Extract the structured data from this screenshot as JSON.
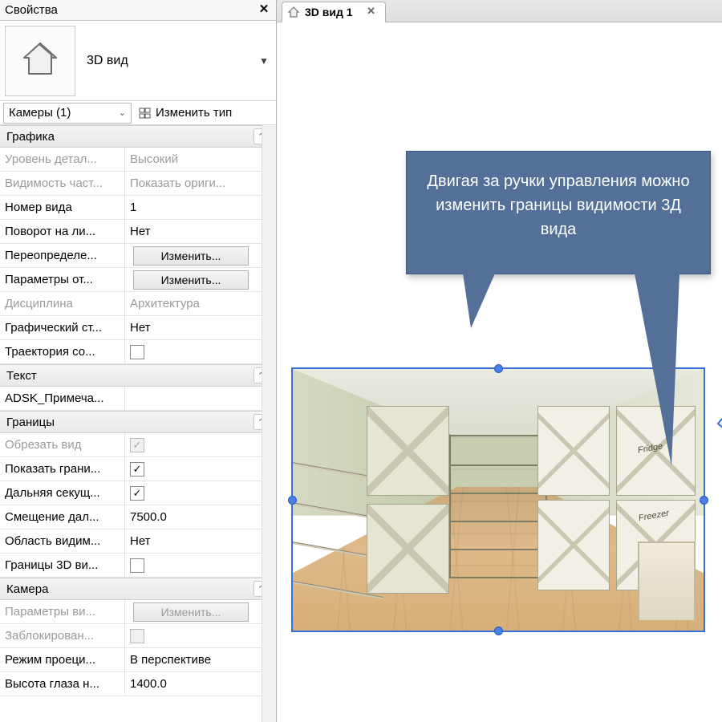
{
  "panel": {
    "title": "Свойства"
  },
  "type_selector": {
    "label": "3D вид"
  },
  "instance": {
    "combo": "Камеры (1)",
    "edit_type": "Изменить тип"
  },
  "callout": {
    "text": "Двигая за ручки управления можно изменить границы видимости 3Д вида"
  },
  "tab": {
    "label": "3D вид 1"
  },
  "buttons": {
    "edit": "Изменить..."
  },
  "scene": {
    "fridge": "Fridge",
    "freezer": "Freezer"
  },
  "groups": [
    {
      "name": "Графика",
      "rows": [
        {
          "label": "Уровень детал...",
          "kind": "text",
          "value": "Высокий",
          "disabled": true
        },
        {
          "label": "Видимость част...",
          "kind": "text",
          "value": "Показать ориги...",
          "disabled": true
        },
        {
          "label": "Номер вида",
          "kind": "text",
          "value": "1",
          "disabled": false
        },
        {
          "label": "Поворот на ли...",
          "kind": "text",
          "value": "Нет",
          "disabled": false
        },
        {
          "label": "Переопределе...",
          "kind": "button",
          "value": "edit",
          "disabled": false
        },
        {
          "label": "Параметры от...",
          "kind": "button",
          "value": "edit",
          "disabled": false
        },
        {
          "label": "Дисциплина",
          "kind": "text",
          "value": "Архитектура",
          "disabled": true
        },
        {
          "label": "Графический ст...",
          "kind": "text",
          "value": "Нет",
          "disabled": false
        },
        {
          "label": "Траектория со...",
          "kind": "check",
          "value": false,
          "disabled": false
        }
      ]
    },
    {
      "name": "Текст",
      "rows": [
        {
          "label": "ADSK_Примеча...",
          "kind": "text",
          "value": "",
          "disabled": false
        }
      ]
    },
    {
      "name": "Границы",
      "rows": [
        {
          "label": "Обрезать вид",
          "kind": "check",
          "value": true,
          "disabled": true
        },
        {
          "label": "Показать грани...",
          "kind": "check",
          "value": true,
          "disabled": false
        },
        {
          "label": "Дальняя секущ...",
          "kind": "check",
          "value": true,
          "disabled": false
        },
        {
          "label": "Смещение дал...",
          "kind": "text",
          "value": "7500.0",
          "disabled": false
        },
        {
          "label": "Область видим...",
          "kind": "text",
          "value": "Нет",
          "disabled": false
        },
        {
          "label": "Границы 3D ви...",
          "kind": "check",
          "value": false,
          "disabled": false
        }
      ]
    },
    {
      "name": "Камера",
      "rows": [
        {
          "label": "Параметры ви...",
          "kind": "button",
          "value": "edit",
          "disabled": true
        },
        {
          "label": "Заблокирован...",
          "kind": "check",
          "value": false,
          "disabled": true
        },
        {
          "label": "Режим проеци...",
          "kind": "text",
          "value": "В перспективе",
          "disabled": false
        },
        {
          "label": "Высота глаза н...",
          "kind": "text",
          "value": "1400.0",
          "disabled": false
        }
      ]
    }
  ]
}
